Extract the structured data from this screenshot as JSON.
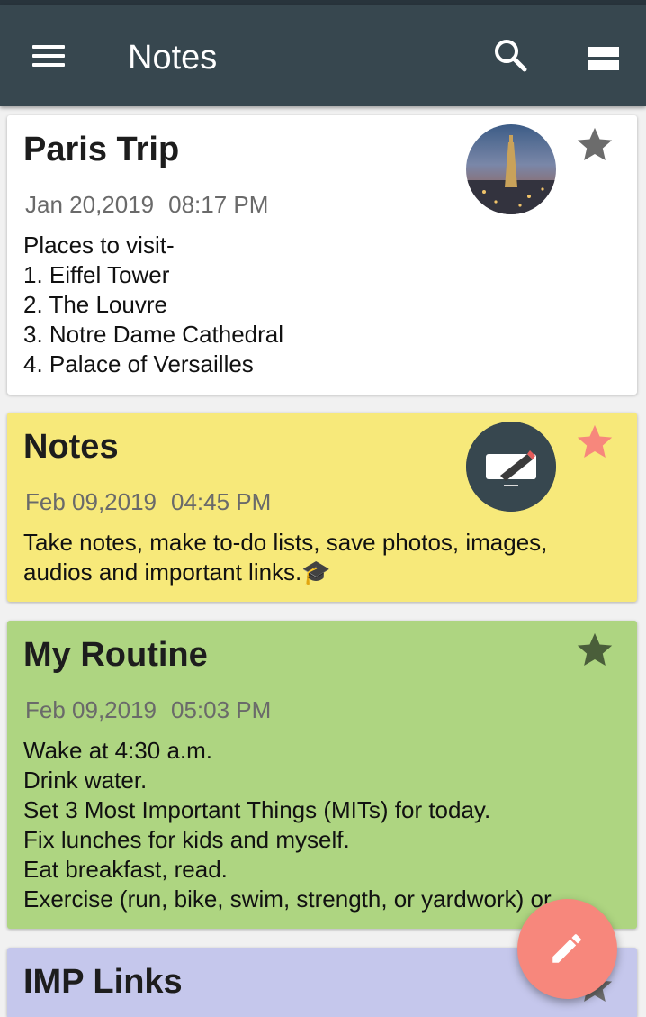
{
  "app": {
    "title": "Notes"
  },
  "icons": {
    "menu": "menu-icon",
    "search": "search-icon",
    "view": "view-toggle-icon",
    "fab": "edit-pencil-icon",
    "star": "star-icon"
  },
  "colors": {
    "appbar": "#37474f",
    "fab": "#f7877c",
    "note_white": "#ffffff",
    "note_yellow": "#f7e97a",
    "note_green": "#aed581",
    "note_purple": "#c5c7ec",
    "star_grey": "#6c6c6c",
    "star_pink": "#f7877c",
    "star_dark_green": "#4a5e3a"
  },
  "notes": [
    {
      "title": "Paris Trip",
      "date": "Jan 20,2019",
      "time": "08:17 PM",
      "lines": [
        "Places to visit-",
        "1. Eiffel Tower",
        "2. The Louvre",
        "3. Notre Dame Cathedral",
        "4. Palace of Versailles"
      ],
      "has_image": true,
      "image": "paris-city-photo",
      "starred_color": "#6c6c6c",
      "color": "#ffffff"
    },
    {
      "title": "Notes",
      "date": "Feb 09,2019",
      "time": "04:45 PM",
      "lines": [
        "Take notes, make to-do lists, save photos, images,",
        "audios and important links.🎓"
      ],
      "has_image": true,
      "image": "notes-app-screenshot",
      "starred_color": "#f7877c",
      "color": "#f7e97a"
    },
    {
      "title": "My Routine",
      "date": "Feb 09,2019",
      "time": "05:03 PM",
      "lines": [
        "Wake at 4:30 a.m.",
        "Drink water.",
        "Set 3 Most Important Things (MITs) for today.",
        "Fix lunches for kids and myself.",
        "Eat breakfast, read.",
        "Exercise (run, bike, swim, strength, or yardwork) or ..."
      ],
      "has_image": false,
      "starred_color": "#4a5e3a",
      "color": "#aed581"
    },
    {
      "title": "IMP Links",
      "color": "#c5c7ec",
      "starred_color": "#6c6c6c"
    }
  ]
}
